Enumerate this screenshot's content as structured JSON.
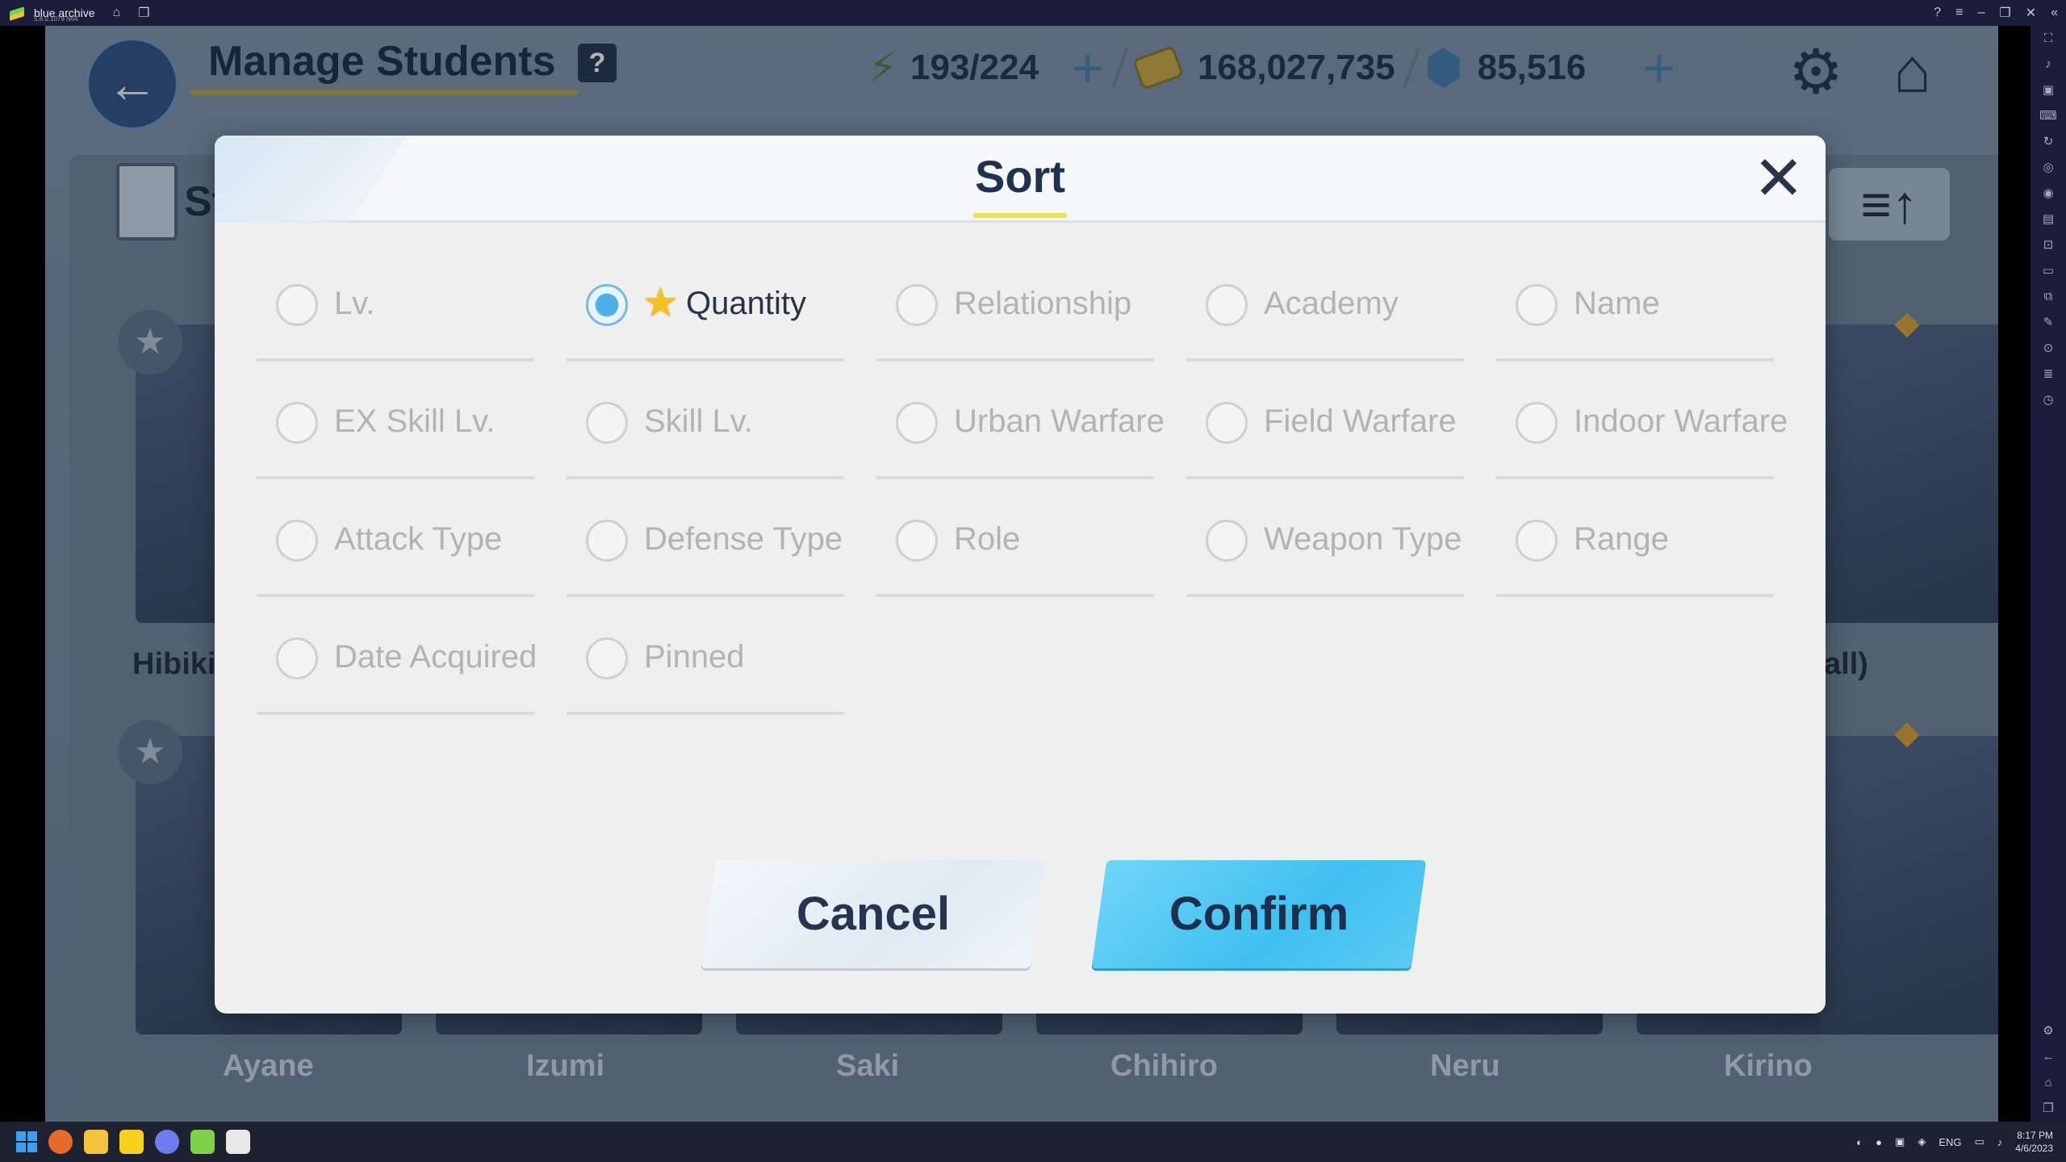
{
  "window": {
    "app_name": "blue archive",
    "version": "5.8.0.1079 N64"
  },
  "game": {
    "screen_title": "Manage Students",
    "help_label": "?",
    "ap": "193/224",
    "credits": "168,027,735",
    "gems": "85,516",
    "list_header": "St",
    "sort_order_label": "≡↑",
    "cards": [
      {
        "name": "Hibiki"
      },
      {
        "name": "all)"
      },
      {
        "name": "Ayane"
      },
      {
        "name": "Izumi"
      },
      {
        "name": "Saki"
      },
      {
        "name": "Chihiro"
      },
      {
        "name": "Neru"
      },
      {
        "name": "Kirino"
      }
    ]
  },
  "modal": {
    "title": "Sort",
    "close_label": "✕",
    "options": [
      {
        "label": "Lv.",
        "selected": false
      },
      {
        "label": "Quantity",
        "selected": true,
        "star": true
      },
      {
        "label": "Relationship",
        "selected": false
      },
      {
        "label": "Academy",
        "selected": false
      },
      {
        "label": "Name",
        "selected": false
      },
      {
        "label": "EX Skill Lv.",
        "selected": false
      },
      {
        "label": "Skill Lv.",
        "selected": false
      },
      {
        "label": "Urban Warfare",
        "selected": false
      },
      {
        "label": "Field Warfare",
        "selected": false
      },
      {
        "label": "Indoor Warfare",
        "selected": false
      },
      {
        "label": "Attack Type",
        "selected": false
      },
      {
        "label": "Defense Type",
        "selected": false
      },
      {
        "label": "Role",
        "selected": false
      },
      {
        "label": "Weapon Type",
        "selected": false
      },
      {
        "label": "Range",
        "selected": false
      },
      {
        "label": "Date Acquired",
        "selected": false
      },
      {
        "label": "Pinned",
        "selected": false
      }
    ],
    "cancel_label": "Cancel",
    "confirm_label": "Confirm"
  },
  "taskbar": {
    "lang": "ENG",
    "time": "8:17 PM",
    "date": "4/6/2023"
  },
  "colors": {
    "accent_confirm": "#3fc0f0",
    "title_underline": "#f1e048",
    "radio_selected": "#4fb0e8"
  }
}
